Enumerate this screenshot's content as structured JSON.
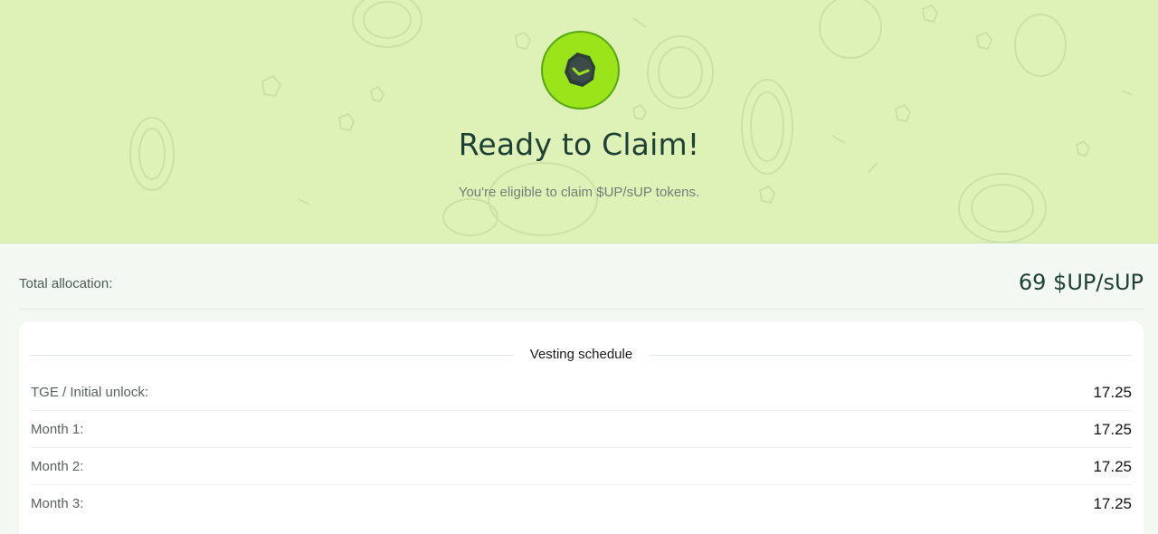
{
  "hero": {
    "title": "Ready to Claim!",
    "subtitle": "You're eligible to claim $UP/sUP tokens.",
    "badge_icon": "token-check-icon",
    "background_color": "#def2b8",
    "badge_color": "#9be41a"
  },
  "total": {
    "label": "Total allocation:",
    "value": "69 $UP/sUP"
  },
  "vesting": {
    "title": "Vesting schedule",
    "rows": [
      {
        "label": "TGE / Initial unlock:",
        "value": "17.25"
      },
      {
        "label": "Month 1:",
        "value": "17.25"
      },
      {
        "label": "Month 2:",
        "value": "17.25"
      },
      {
        "label": "Month 3:",
        "value": "17.25"
      }
    ]
  }
}
